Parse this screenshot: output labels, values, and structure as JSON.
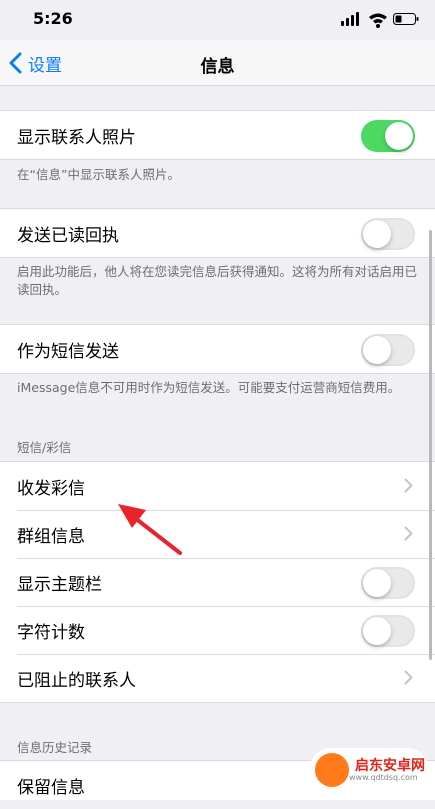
{
  "status": {
    "time": "5:26"
  },
  "nav": {
    "back_label": "设置",
    "title": "信息"
  },
  "contacts_photo": {
    "label": "显示联系人照片",
    "on": true,
    "note": "在“信息”中显示联系人照片。"
  },
  "read_receipts": {
    "label": "发送已读回执",
    "on": false,
    "note": "启用此功能后，他人将在您读完信息后获得通知。这将为所有对话启用已读回执。"
  },
  "send_as_sms": {
    "label": "作为短信发送",
    "on": false,
    "note": "iMessage信息不可用时作为短信发送。可能要支付运营商短信费用。"
  },
  "sms_section": {
    "header": "短信/彩信",
    "items": [
      {
        "label": "收发彩信",
        "kind": "chevron"
      },
      {
        "label": "群组信息",
        "kind": "chevron"
      },
      {
        "label": "显示主题栏",
        "kind": "toggle",
        "on": false
      },
      {
        "label": "字符计数",
        "kind": "toggle",
        "on": false
      },
      {
        "label": "已阻止的联系人",
        "kind": "chevron"
      }
    ]
  },
  "history_section": {
    "header": "信息历史记录",
    "items": [
      {
        "label": "保留信息"
      }
    ]
  },
  "watermark": {
    "text": "启东安卓网",
    "url": "www.qdtdsq.com"
  },
  "colors": {
    "accent": "#0a7aff",
    "toggle_on": "#4cd964",
    "arrow": "#e8232b"
  }
}
